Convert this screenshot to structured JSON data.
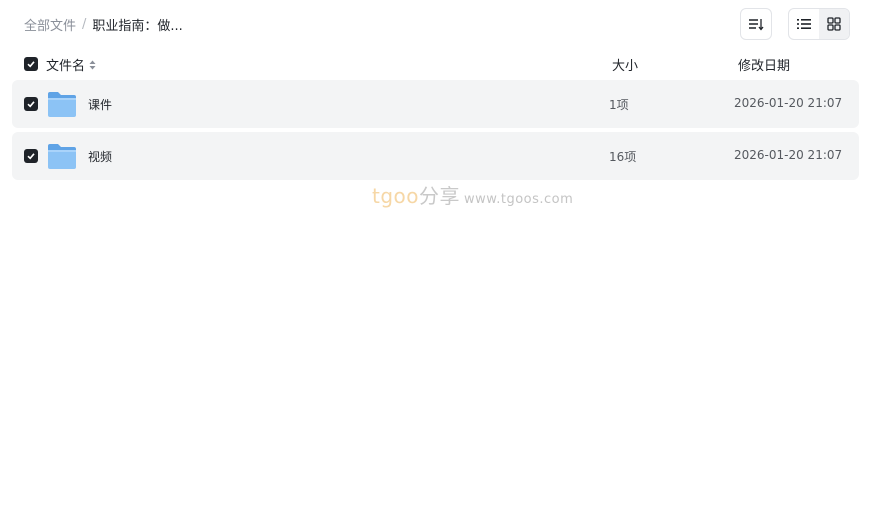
{
  "breadcrumb": {
    "root": "全部文件",
    "separator": "/",
    "current": "职业指南：做..."
  },
  "toolbar": {
    "sort_icon": "sort-lines-icon",
    "list_view_icon": "list-view-icon",
    "grid_view_icon": "grid-view-icon",
    "active_view": "grid"
  },
  "header": {
    "name": "文件名",
    "size": "大小",
    "date": "修改日期"
  },
  "files": [
    {
      "name": "课件",
      "size": "1项",
      "date": "2026-01-20 21:07",
      "icon": "folder-icon",
      "checked": true
    },
    {
      "name": "视频",
      "size": "16项",
      "date": "2026-01-20 21:07",
      "icon": "folder-icon",
      "checked": true
    }
  ],
  "watermark": {
    "brand_a": "tgoo",
    "brand_b": "分享",
    "url": "www.tgoos.com"
  },
  "colors": {
    "row_bg": "#f3f4f5",
    "checkbox": "#1f2329",
    "folder": "#6fb0ee"
  }
}
